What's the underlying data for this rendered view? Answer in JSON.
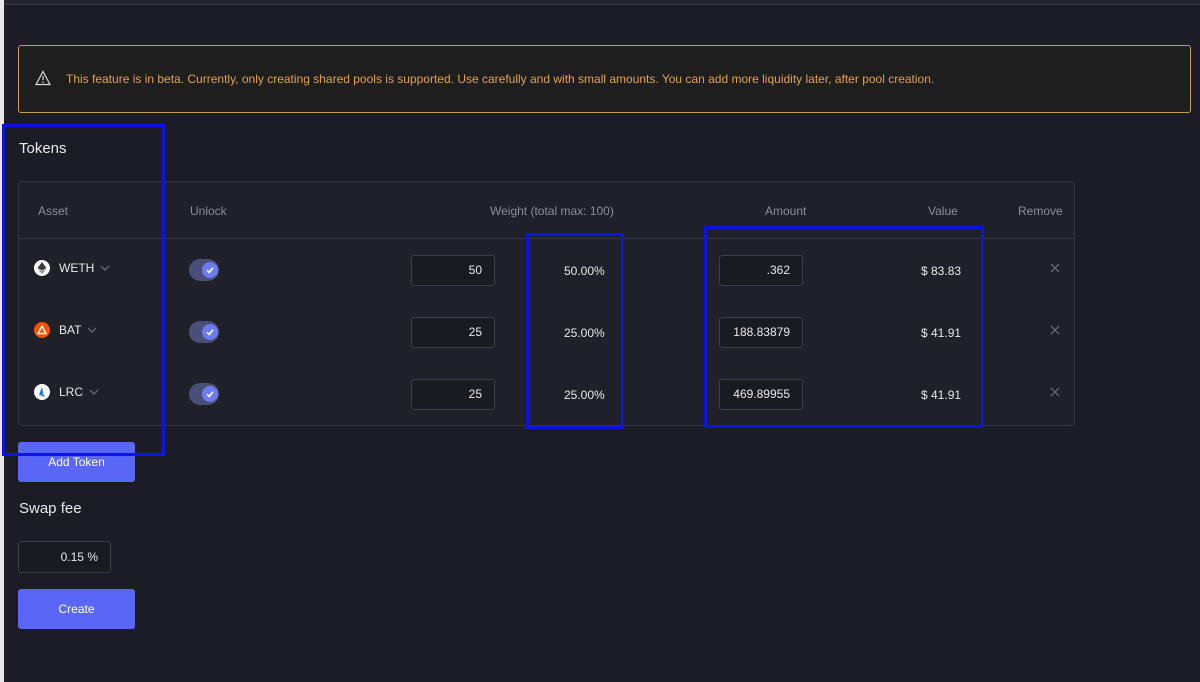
{
  "banner": {
    "icon": "warning-triangle-icon",
    "text": "This feature is in beta. Currently, only creating shared pools is supported. Use carefully and with small amounts. You can add more liquidity later, after pool creation."
  },
  "tokens_section": {
    "title": "Tokens",
    "columns": {
      "asset": "Asset",
      "unlock": "Unlock",
      "weight": "Weight (total max: 100)",
      "amount": "Amount",
      "value": "Value",
      "remove": "Remove"
    },
    "rows": [
      {
        "symbol": "WETH",
        "icon": "eth-icon",
        "unlocked": true,
        "weight": "50",
        "percent": "50.00%",
        "amount": ".362",
        "value": "$ 83.83"
      },
      {
        "symbol": "BAT",
        "icon": "bat-icon",
        "unlocked": true,
        "weight": "25",
        "percent": "25.00%",
        "amount": "188.83879",
        "value": "$ 41.91"
      },
      {
        "symbol": "LRC",
        "icon": "lrc-icon",
        "unlocked": true,
        "weight": "25",
        "percent": "25.00%",
        "amount": "469.89955",
        "value": "$ 41.91"
      }
    ],
    "add_token_label": "Add Token"
  },
  "swap_fee": {
    "title": "Swap fee",
    "value": "0.15",
    "unit": "%"
  },
  "create_label": "Create",
  "colors": {
    "background": "#1c1d24",
    "accent": "#5a66f5",
    "warning": "#e2a04d",
    "highlight": "#0a16e0"
  }
}
